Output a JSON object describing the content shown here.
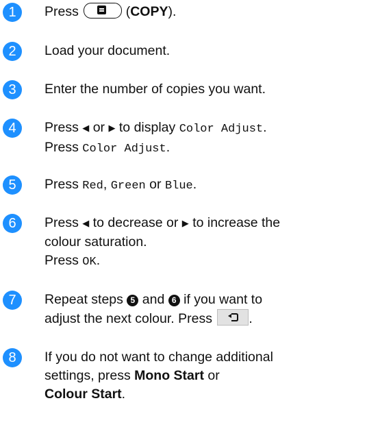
{
  "steps": [
    {
      "number": "1",
      "press_word": "Press",
      "copy_key_icon": "copy-key-icon",
      "copy_paren_open": "(",
      "copy_label": "COPY",
      "copy_paren_close": ")."
    },
    {
      "number": "2",
      "text": "Load your document."
    },
    {
      "number": "3",
      "text": "Enter the number of copies you want."
    },
    {
      "number": "4",
      "press_word": "Press",
      "or_word": "or",
      "to_display": "to display",
      "menu_item": "Color Adjust",
      "end_dot": ".",
      "press_word_2": "Press",
      "menu_item_2": "Color Adjust",
      "end_dot_2": "."
    },
    {
      "number": "5",
      "press_word": "Press",
      "red": "Red",
      "comma": ",",
      "green": "Green",
      "or_word": "or",
      "blue": "Blue",
      "end_dot": "."
    },
    {
      "number": "6",
      "press_word": "Press",
      "to_decrease": "to decrease or",
      "to_increase": "to increase the",
      "line2": "colour saturation.",
      "press_word_2": "Press",
      "ok": "OK",
      "end_dot": "."
    },
    {
      "number": "7",
      "repeat_text": "Repeat steps",
      "ref_step_a": "5",
      "and_word": "and",
      "ref_step_b": "6",
      "line1_end": "if you want to",
      "line2": "adjust the next colour. Press",
      "back_key_icon": "back-key-icon",
      "end_dot": "."
    },
    {
      "number": "8",
      "line1": "If you do not want to change additional",
      "line2_a": "settings, press",
      "mono_start": "Mono Start",
      "or_word": "or",
      "colour_start": "Colour Start",
      "end_dot": "."
    }
  ],
  "colors": {
    "step_badge": "#1e90ff",
    "text": "#111111",
    "key_fill": "#e2e2e2"
  }
}
